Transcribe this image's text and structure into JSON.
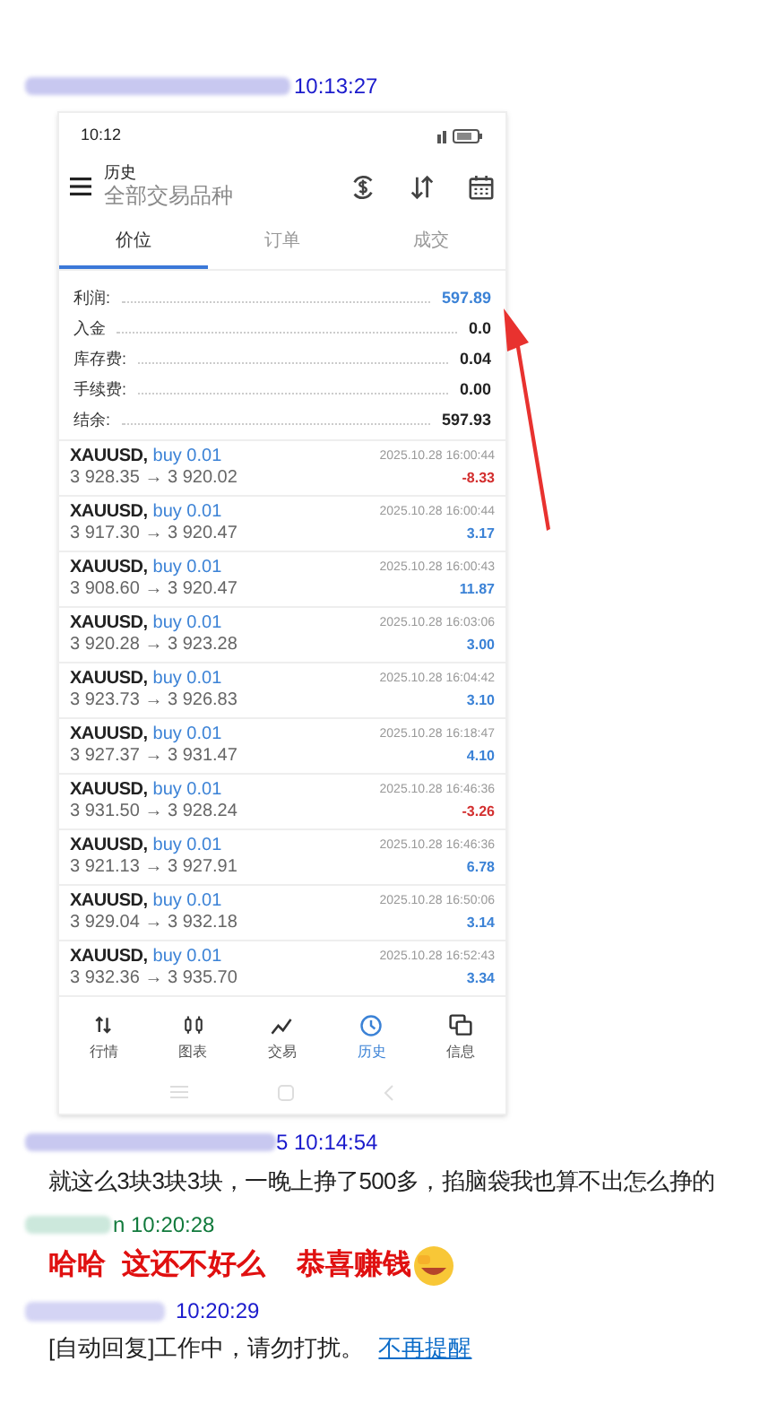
{
  "messages_top": {
    "time": "10:13:27"
  },
  "phone": {
    "status_time": "10:12",
    "header": {
      "title": "历史",
      "subtitle": "全部交易品种"
    },
    "tabs": [
      {
        "label": "价位",
        "selected": true
      },
      {
        "label": "订单",
        "selected": false
      },
      {
        "label": "成交",
        "selected": false
      }
    ],
    "summary": [
      {
        "label": "利润:",
        "value": "597.89",
        "highlight": true
      },
      {
        "label": "入金",
        "value": "0.0",
        "highlight": false
      },
      {
        "label": "库存费:",
        "value": "0.04",
        "highlight": false
      },
      {
        "label": "手续费:",
        "value": "0.00",
        "highlight": false
      },
      {
        "label": "结余:",
        "value": "597.93",
        "highlight": false
      }
    ],
    "deals": [
      {
        "symbol": "XAUUSD,",
        "side": "buy 0.01",
        "prices": "3 928.35 → 3 920.02",
        "time": "2025.10.28 16:00:44",
        "profit": "-8.33",
        "loss": true
      },
      {
        "symbol": "XAUUSD,",
        "side": "buy 0.01",
        "prices": "3 917.30 → 3 920.47",
        "time": "2025.10.28 16:00:44",
        "profit": "3.17",
        "loss": false
      },
      {
        "symbol": "XAUUSD,",
        "side": "buy 0.01",
        "prices": "3 908.60 → 3 920.47",
        "time": "2025.10.28 16:00:43",
        "profit": "11.87",
        "loss": false
      },
      {
        "symbol": "XAUUSD,",
        "side": "buy 0.01",
        "prices": "3 920.28 → 3 923.28",
        "time": "2025.10.28 16:03:06",
        "profit": "3.00",
        "loss": false
      },
      {
        "symbol": "XAUUSD,",
        "side": "buy 0.01",
        "prices": "3 923.73 → 3 926.83",
        "time": "2025.10.28 16:04:42",
        "profit": "3.10",
        "loss": false
      },
      {
        "symbol": "XAUUSD,",
        "side": "buy 0.01",
        "prices": "3 927.37 → 3 931.47",
        "time": "2025.10.28 16:18:47",
        "profit": "4.10",
        "loss": false
      },
      {
        "symbol": "XAUUSD,",
        "side": "buy 0.01",
        "prices": "3 931.50 → 3 928.24",
        "time": "2025.10.28 16:46:36",
        "profit": "-3.26",
        "loss": true
      },
      {
        "symbol": "XAUUSD,",
        "side": "buy 0.01",
        "prices": "3 921.13 → 3 927.91",
        "time": "2025.10.28 16:46:36",
        "profit": "6.78",
        "loss": false
      },
      {
        "symbol": "XAUUSD,",
        "side": "buy 0.01",
        "prices": "3 929.04 → 3 932.18",
        "time": "2025.10.28 16:50:06",
        "profit": "3.14",
        "loss": false
      },
      {
        "symbol": "XAUUSD,",
        "side": "buy 0.01",
        "prices": "3 932.36 → 3 935.70",
        "time": "2025.10.28 16:52:43",
        "profit": "3.34",
        "loss": false
      }
    ],
    "nav": [
      {
        "label": "行情",
        "kind": "quotes",
        "selected": false
      },
      {
        "label": "图表",
        "kind": "chart",
        "selected": false
      },
      {
        "label": "交易",
        "kind": "trade",
        "selected": false
      },
      {
        "label": "历史",
        "kind": "history",
        "selected": true
      },
      {
        "label": "信息",
        "kind": "messages",
        "selected": false
      }
    ]
  },
  "messages": [
    {
      "header": "5 10:14:54",
      "color": "#1a1acc",
      "kind": "plain",
      "text": "就这么3块3块3块，一晚上挣了500多，掐脑袋我也算不出怎么挣的"
    },
    {
      "header": "n  10:20:28",
      "color": "#117a3c",
      "kind": "emphasis",
      "text": "哈哈  这还不好么    恭喜赚钱"
    },
    {
      "header": "10:20:29",
      "color": "#1a1acc",
      "kind": "autoreply",
      "text": "[自动回复]工作中，请勿打扰。",
      "link": "不再提醒"
    }
  ]
}
